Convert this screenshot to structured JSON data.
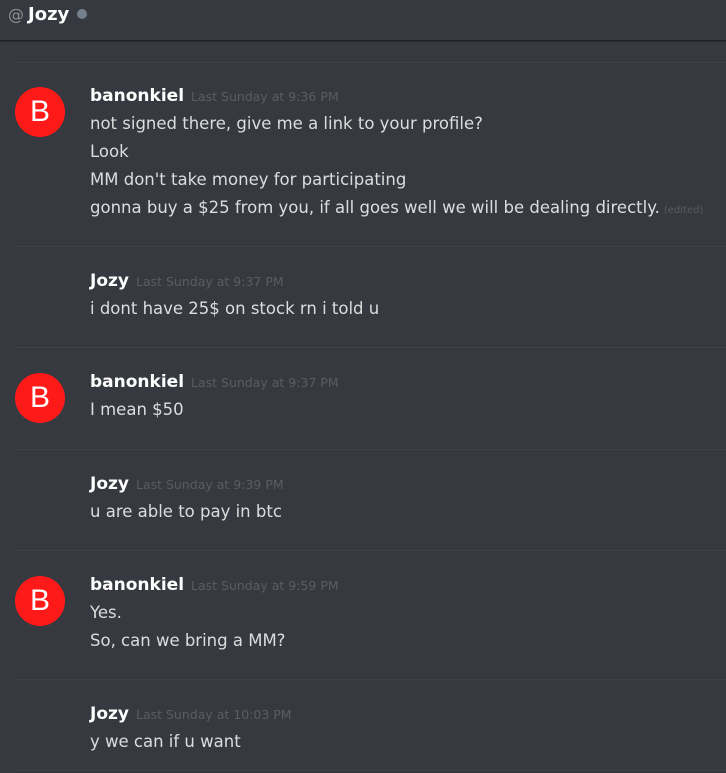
{
  "header": {
    "at_symbol": "@",
    "username": "Jozy"
  },
  "messages": [
    {
      "author": "banonkiel",
      "avatar_letter": "B",
      "timestamp": "Last Sunday at 9:36 PM",
      "lines": [
        "not signed there, give me a link to your profile?",
        "Look",
        "MM don't take money for participating",
        "gonna buy a $25 from you, if all goes well we will be dealing directly."
      ],
      "edited_label": "(edited)"
    },
    {
      "author": "Jozy",
      "timestamp": "Last Sunday at 9:37 PM",
      "lines": [
        "i dont have 25$ on stock rn i told u"
      ]
    },
    {
      "author": "banonkiel",
      "avatar_letter": "B",
      "timestamp": "Last Sunday at 9:37 PM",
      "lines": [
        "I mean $50"
      ]
    },
    {
      "author": "Jozy",
      "timestamp": "Last Sunday at 9:39 PM",
      "lines": [
        "u are able to pay in btc"
      ]
    },
    {
      "author": "banonkiel",
      "avatar_letter": "B",
      "timestamp": "Last Sunday at 9:59 PM",
      "lines": [
        "Yes.",
        "So, can we bring a MM?"
      ]
    },
    {
      "author": "Jozy",
      "timestamp": "Last Sunday at 10:03 PM",
      "lines": [
        "y we can if u want"
      ]
    }
  ],
  "colors": {
    "background": "#36393f",
    "avatar": "#ff1a1a",
    "status_offline": "#747f8d"
  }
}
